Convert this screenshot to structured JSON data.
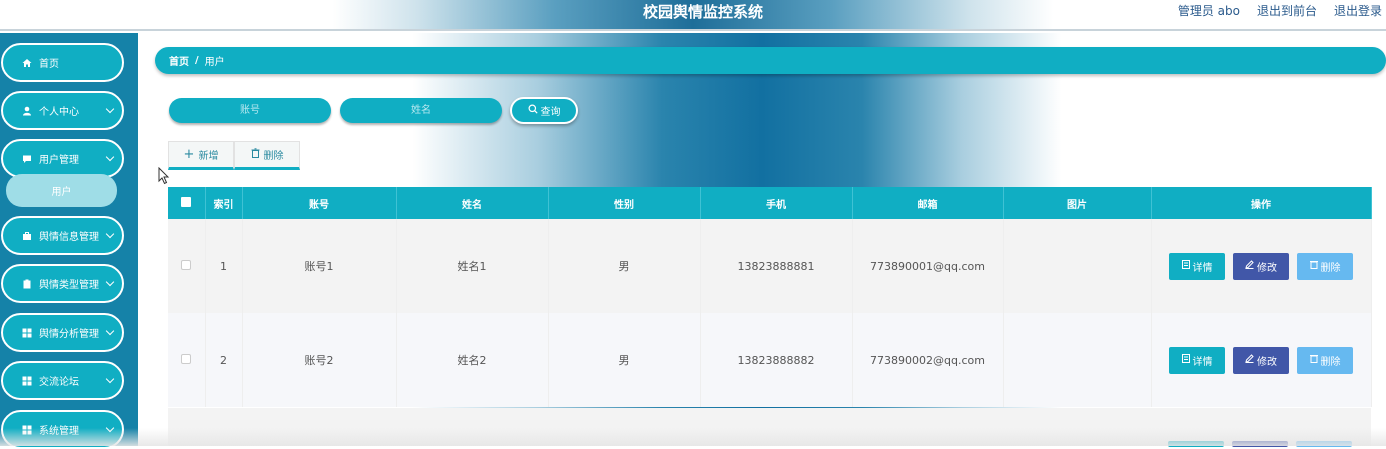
{
  "header": {
    "title": "校园舆情监控系统",
    "user_label": "管理员 abo",
    "front_link": "退出到前台",
    "logout_link": "退出登录"
  },
  "sidebar": {
    "items": [
      {
        "label": "首页",
        "icon": "home-icon",
        "has_arrow": false
      },
      {
        "label": "个人中心",
        "icon": "user-icon",
        "has_arrow": true
      },
      {
        "label": "用户管理",
        "icon": "chat-icon",
        "has_arrow": true
      },
      {
        "label": "舆情信息管理",
        "icon": "briefcase-icon",
        "has_arrow": true
      },
      {
        "label": "舆情类型管理",
        "icon": "clipboard-icon",
        "has_arrow": true
      },
      {
        "label": "舆情分析管理",
        "icon": "grid-icon",
        "has_arrow": true
      },
      {
        "label": "交流论坛",
        "icon": "grid-icon",
        "has_arrow": true
      },
      {
        "label": "系统管理",
        "icon": "grid-icon",
        "has_arrow": true
      }
    ],
    "submenu_label": "用户"
  },
  "breadcrumb": {
    "home": "首页",
    "separator": "/",
    "current": "用户"
  },
  "search": {
    "account_placeholder": "账号",
    "name_placeholder": "姓名",
    "button_label": "查询"
  },
  "actions": {
    "add_label": "新增",
    "delete_label": "删除"
  },
  "table": {
    "columns": [
      "索引",
      "账号",
      "姓名",
      "性别",
      "手机",
      "邮箱",
      "图片",
      "操作"
    ],
    "rows": [
      {
        "index": "1",
        "account": "账号1",
        "name": "姓名1",
        "gender": "男",
        "phone": "13823888881",
        "email": "773890001@qq.com",
        "image": ""
      },
      {
        "index": "2",
        "account": "账号2",
        "name": "姓名2",
        "gender": "男",
        "phone": "13823888882",
        "email": "773890002@qq.com",
        "image": ""
      }
    ],
    "row_actions": {
      "detail": "详情",
      "edit": "修改",
      "delete": "删除"
    }
  },
  "colors": {
    "primary": "#10aec3",
    "sidebar_bg": "#1582a8",
    "edit": "#4157a8",
    "delete": "#66b9f0"
  }
}
